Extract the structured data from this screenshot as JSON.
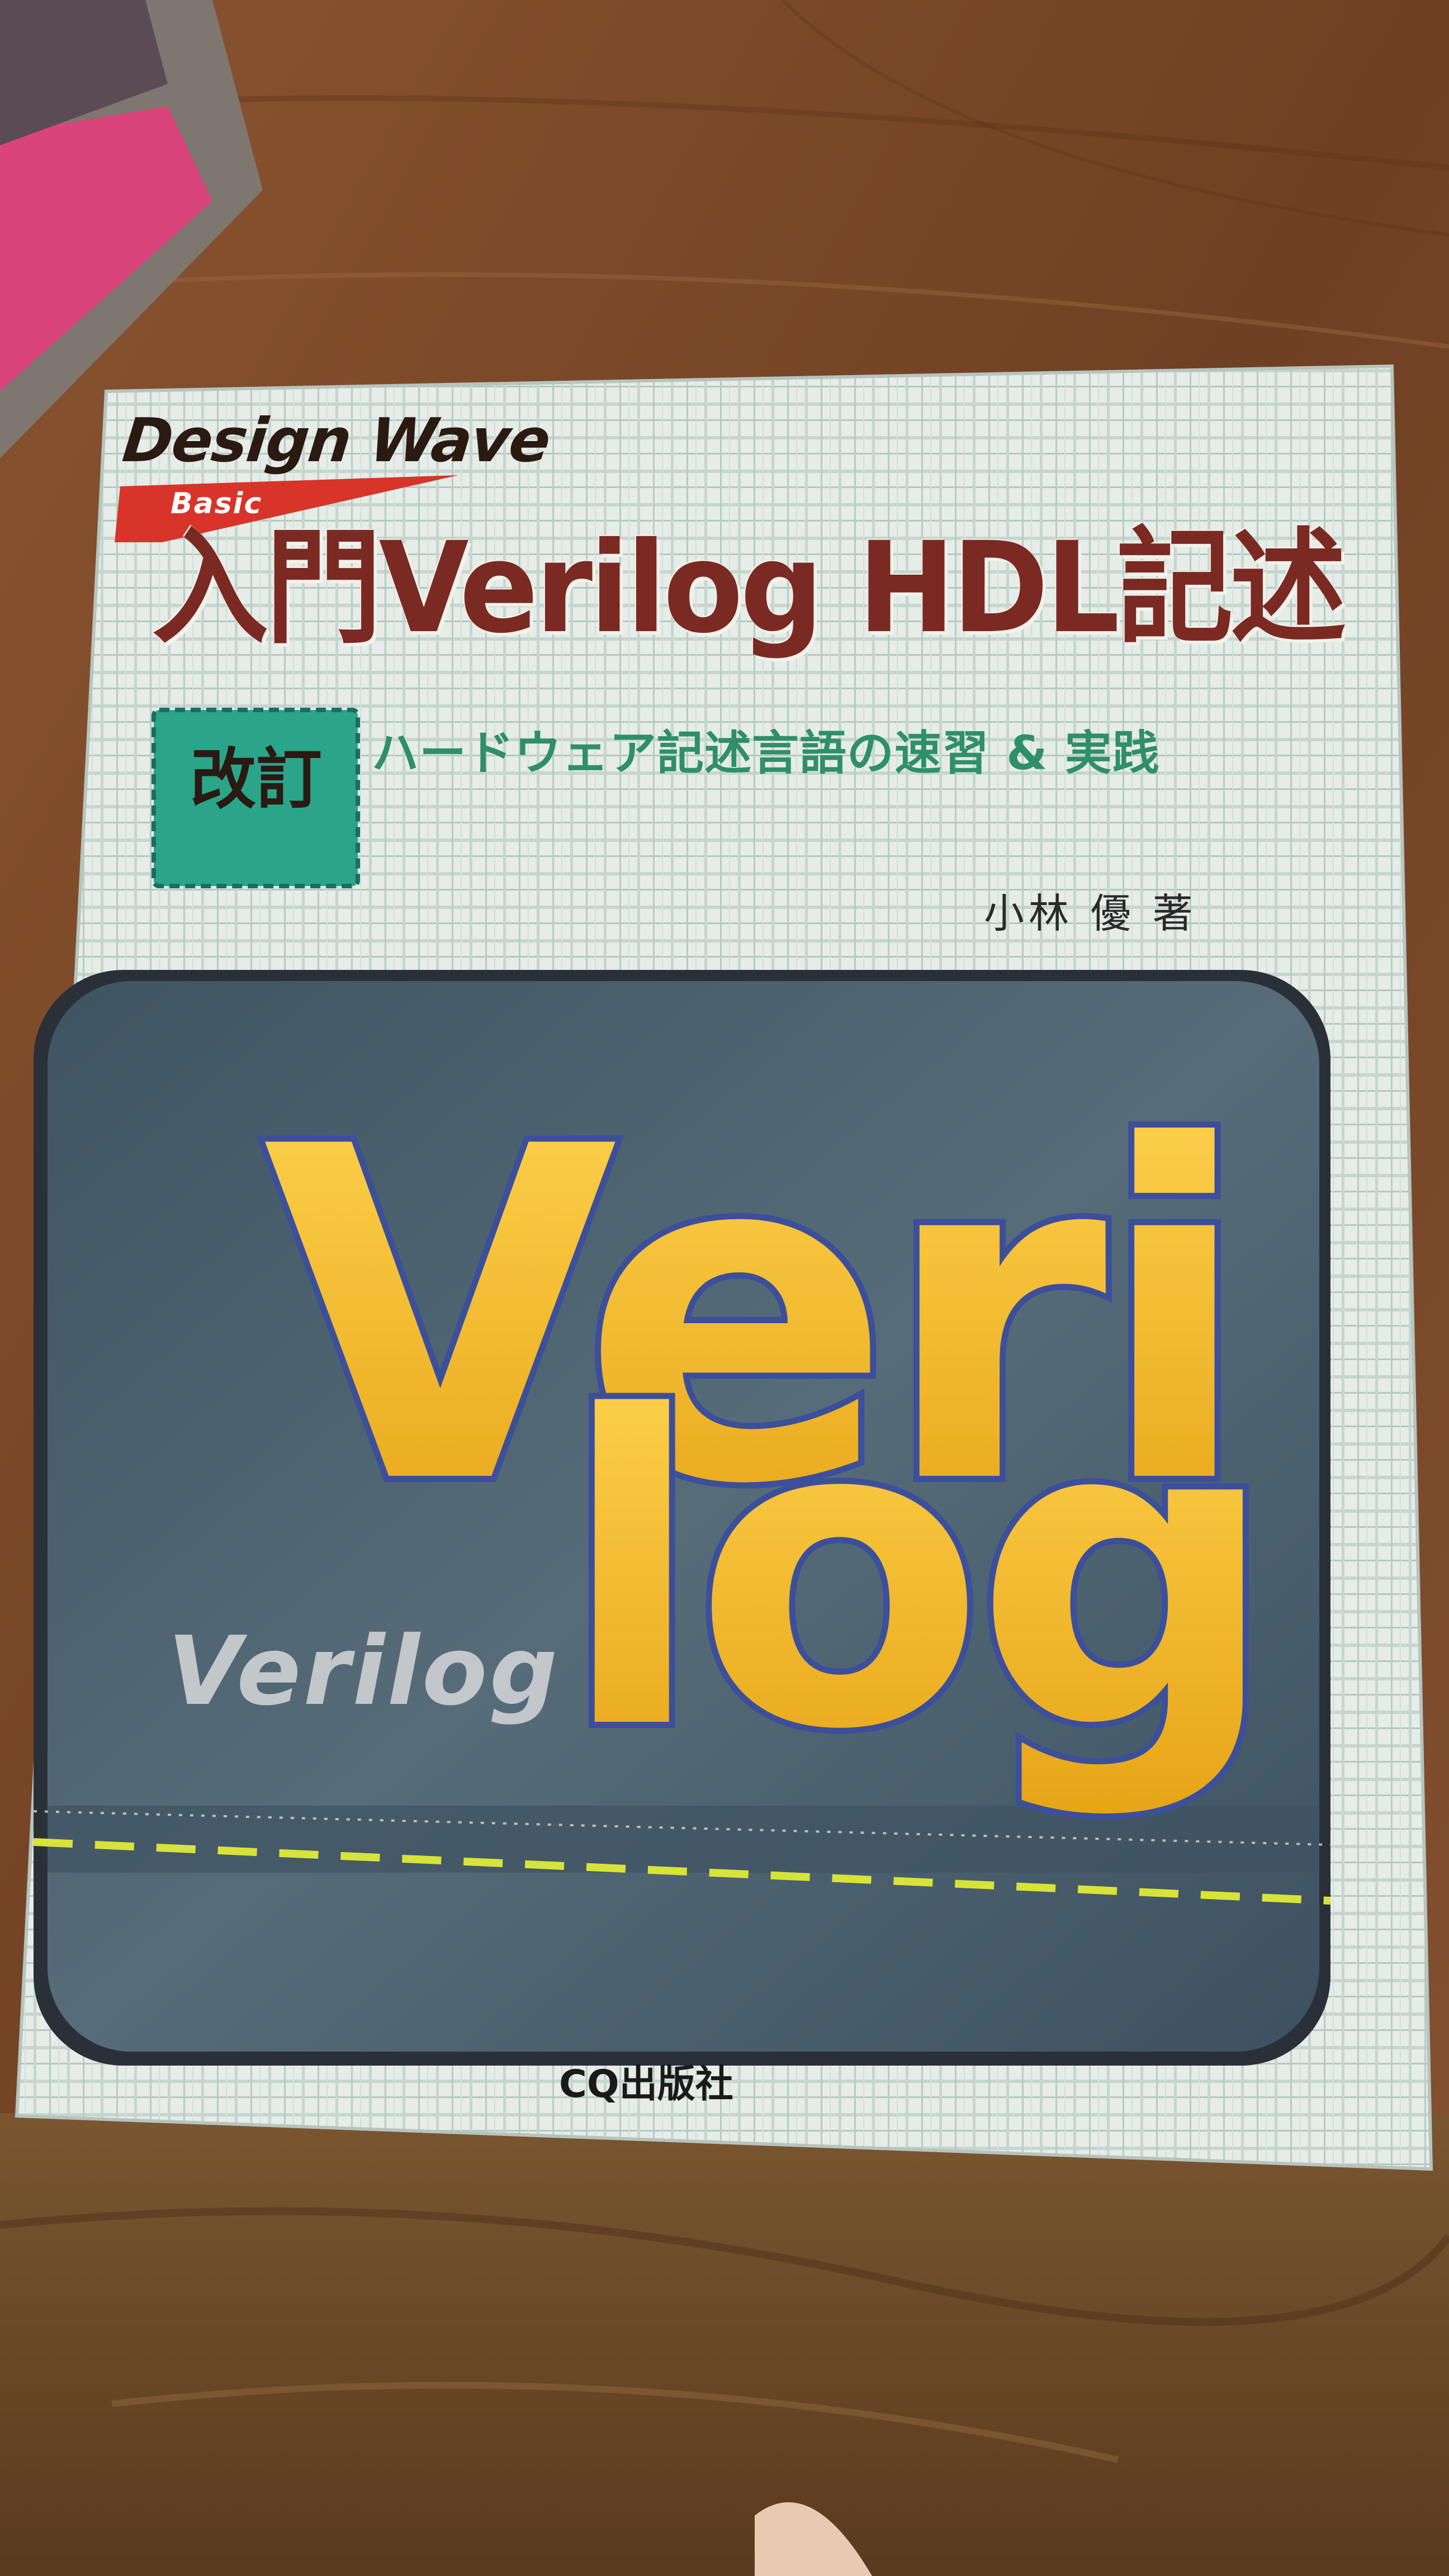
{
  "cover": {
    "series_brand": "Design Wave",
    "series_sub": "Basic",
    "title": "入門Verilog HDL記述",
    "edition_badge": "改訂",
    "subtitle": "ハードウェア記述言語の速習 & 実践",
    "author": "小林 優 著",
    "art_text_top": "Veri",
    "art_text_bottom": "log",
    "art_text_small": "Verilog",
    "publisher": "CQ出版社"
  },
  "colors": {
    "title": "#7a2a22",
    "subtitle": "#2f8f6a",
    "badge": "#2aa58a",
    "art_letters": "#f3b21f",
    "art_background": "#4d6170",
    "cover_background": "#dfe9e4",
    "table_wood": "#7a4a25"
  }
}
